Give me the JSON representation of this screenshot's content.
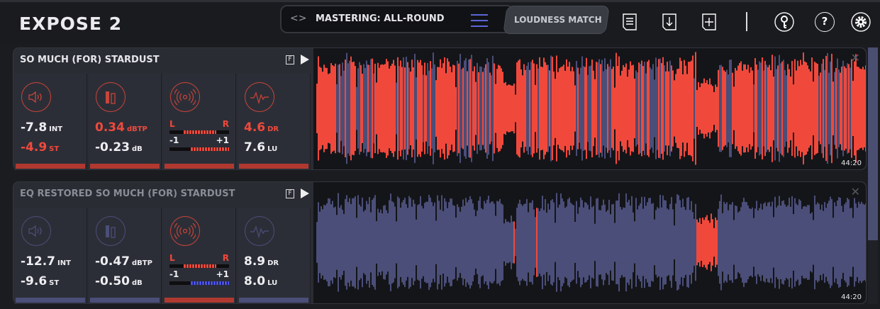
{
  "app": {
    "title": "EXPOSE 2"
  },
  "preset": {
    "name": "MASTERING: ALL-ROUND",
    "nav_glyph": "<>"
  },
  "toolbar": {
    "loudness_match": "LOUDNESS MATCH",
    "icons": [
      "report-icon",
      "export-icon",
      "add-file-icon",
      "key-icon",
      "help-icon",
      "settings-icon"
    ],
    "help_glyph": "?"
  },
  "colors": {
    "accent_red": "#f0493c",
    "accent_blue": "#4b4e78",
    "menu_blue": "#5a66d8"
  },
  "tracks": [
    {
      "name": "SO MUCH (FOR) STARDUST",
      "f_label": "F",
      "duration": "44:20",
      "loudness": {
        "value": "-7.8",
        "unit": "INT",
        "st_value": "-4.9",
        "st_unit": "ST",
        "status": "fail"
      },
      "peak": {
        "value": "0.34",
        "unit": "dBTP",
        "db_value": "-0.23",
        "db_unit": "dB",
        "status": "fail"
      },
      "stereo": {
        "l": "L",
        "r": "R",
        "minus": "-1",
        "plus": "+1",
        "balance": 0.5,
        "correlation": 0.75,
        "status": "fail"
      },
      "dynamics": {
        "value": "4.6",
        "unit": "DR",
        "lu_value": "7.6",
        "lu_unit": "LU",
        "status": "fail"
      }
    },
    {
      "name": "EQ RESTORED SO MUCH (FOR) STARDUST",
      "f_label": "F",
      "duration": "44:20",
      "loudness": {
        "value": "-12.7",
        "unit": "INT",
        "st_value": "-9.6",
        "st_unit": "ST",
        "status": "ok"
      },
      "peak": {
        "value": "-0.47",
        "unit": "dBTP",
        "db_value": "-0.50",
        "db_unit": "dB",
        "status": "ok"
      },
      "stereo": {
        "l": "L",
        "r": "R",
        "minus": "-1",
        "plus": "+1",
        "balance": 0.5,
        "correlation": 0.75,
        "status": "fail"
      },
      "dynamics": {
        "value": "8.9",
        "unit": "DR",
        "lu_value": "8.0",
        "lu_unit": "LU",
        "status": "ok"
      }
    }
  ]
}
